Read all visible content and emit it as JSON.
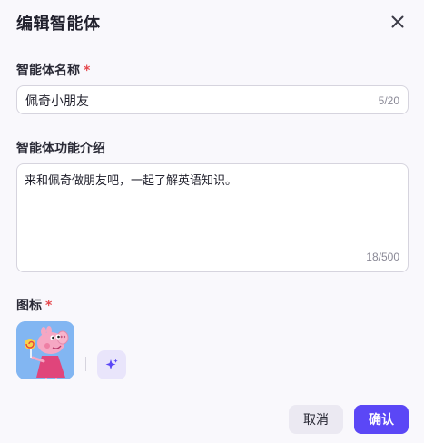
{
  "dialog": {
    "title": "编辑智能体",
    "close_icon": "close-icon"
  },
  "name_field": {
    "label": "智能体名称",
    "required_mark": "*",
    "value": "佩奇小朋友",
    "counter": "5/20"
  },
  "desc_field": {
    "label": "智能体功能介绍",
    "value": "来和佩奇做朋友吧，一起了解英语知识。",
    "counter": "18/500"
  },
  "icon_field": {
    "label": "图标",
    "required_mark": "*",
    "avatar": "peppa-pig-avatar",
    "ai_generate_icon": "sparkle-icon"
  },
  "footer": {
    "cancel_label": "取消",
    "confirm_label": "确认"
  },
  "colors": {
    "primary": "#5b47f6",
    "required": "#e5484d",
    "background": "#f9f8fc"
  }
}
